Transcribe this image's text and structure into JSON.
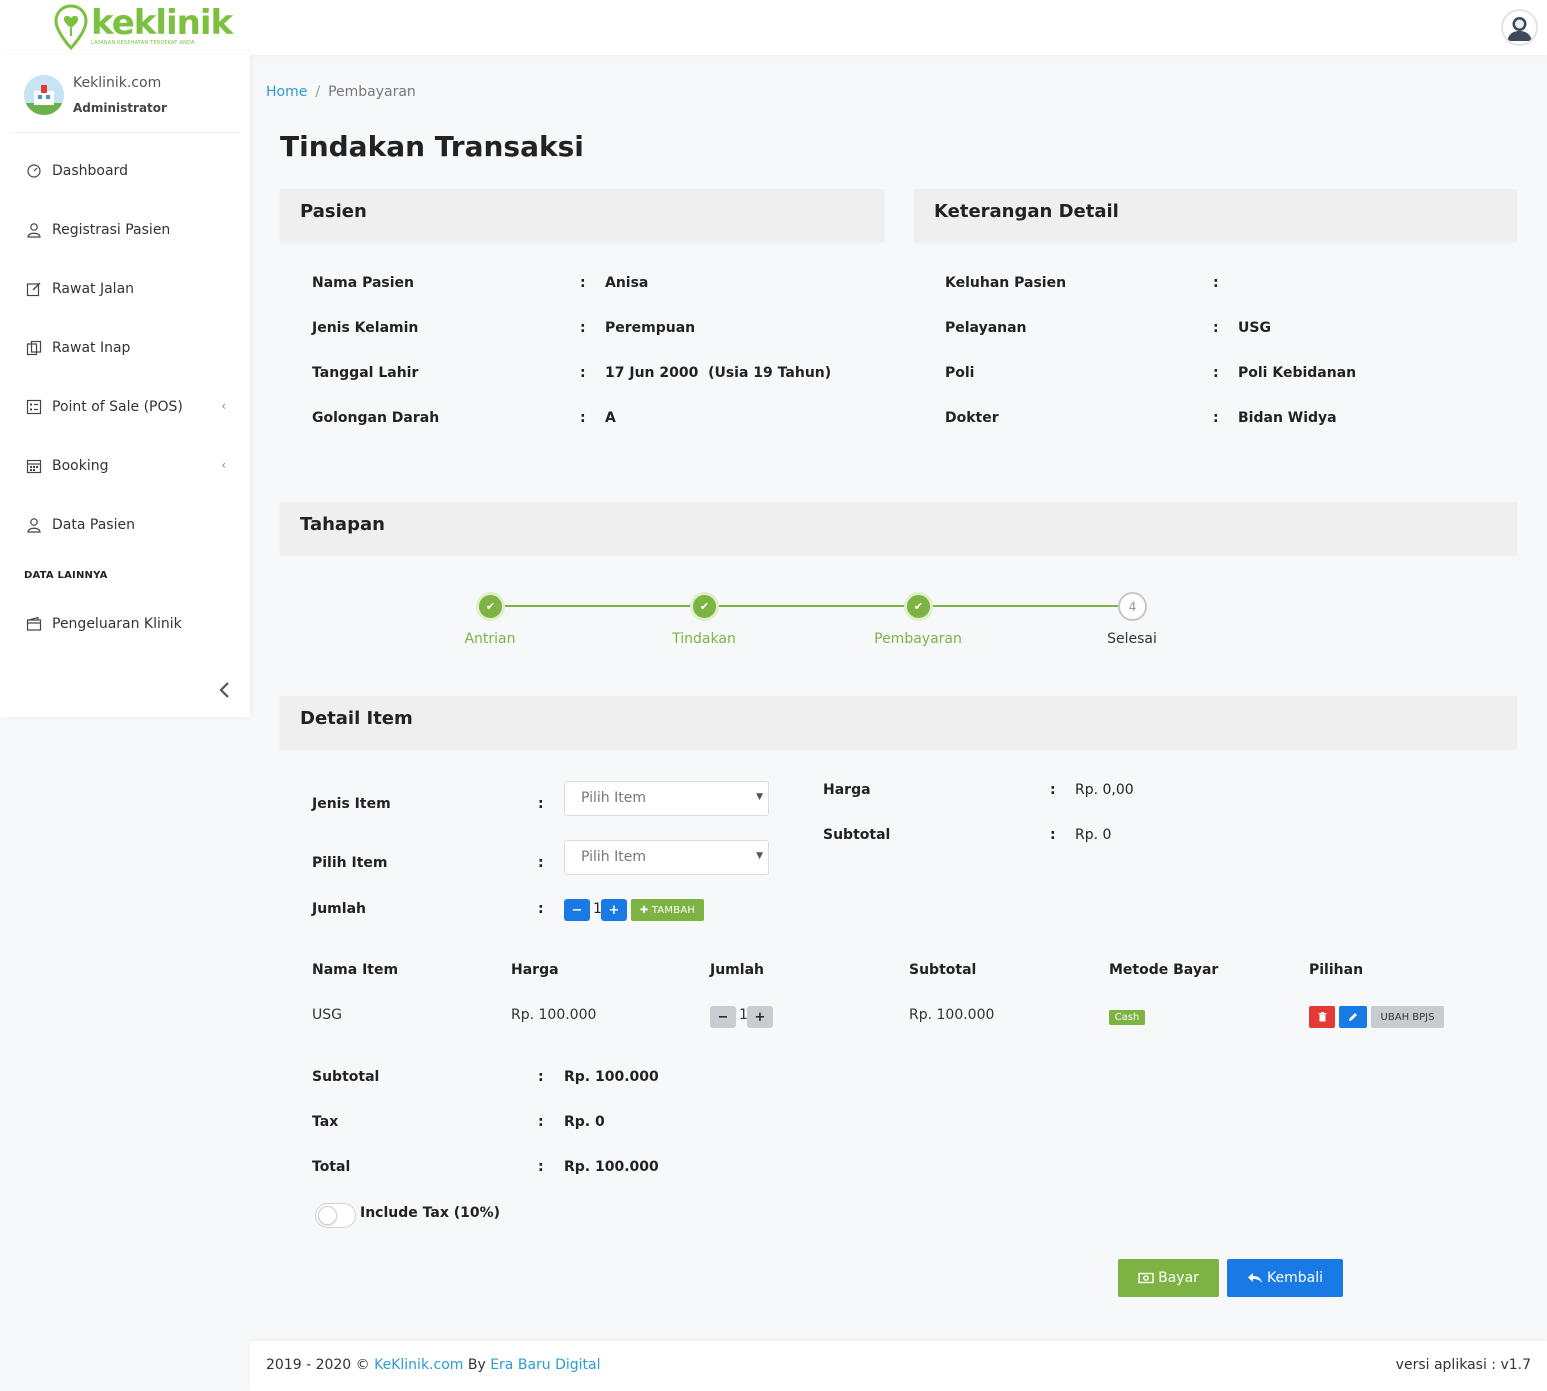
{
  "brand": {
    "name": "keklinik",
    "tagline": "LAYANAN KESEHATAN TERDEKAT ANDA"
  },
  "user": {
    "site": "Keklinik.com",
    "role": "Administrator"
  },
  "sidebar": {
    "items": [
      {
        "label": "Dashboard",
        "icon": "dashboard-icon"
      },
      {
        "label": "Registrasi Pasien",
        "icon": "user-icon"
      },
      {
        "label": "Rawat Jalan",
        "icon": "edit-icon"
      },
      {
        "label": "Rawat Inap",
        "icon": "copy-icon"
      },
      {
        "label": "Point of Sale (POS)",
        "icon": "list-icon",
        "chevron": "‹"
      },
      {
        "label": "Booking",
        "icon": "calendar-icon",
        "chevron": "‹"
      },
      {
        "label": "Data Pasien",
        "icon": "user-icon"
      }
    ],
    "section_label": "DATA LAINNYA",
    "extra_items": [
      {
        "label": "Pengeluaran Klinik",
        "icon": "wallet-icon"
      }
    ]
  },
  "breadcrumb": {
    "home": "Home",
    "separator": "/",
    "current": "Pembayaran"
  },
  "page_title": "Tindakan Transaksi",
  "pasien": {
    "title": "Pasien",
    "rows": [
      {
        "label": "Nama Pasien",
        "value": "Anisa"
      },
      {
        "label": "Jenis Kelamin",
        "value": "Perempuan"
      },
      {
        "label": "Tanggal Lahir",
        "value": "17 Jun 2000  (Usia 19 Tahun)"
      },
      {
        "label": "Golongan Darah",
        "value": "A"
      }
    ]
  },
  "keterangan": {
    "title": "Keterangan Detail",
    "rows": [
      {
        "label": "Keluhan Pasien",
        "value": ""
      },
      {
        "label": "Pelayanan",
        "value": "USG"
      },
      {
        "label": "Poli",
        "value": "Poli Kebidanan"
      },
      {
        "label": "Dokter",
        "value": "Bidan Widya"
      }
    ]
  },
  "tahapan": {
    "title": "Tahapan",
    "steps": [
      {
        "label": "Antrian",
        "done": true,
        "mark": "✔"
      },
      {
        "label": "Tindakan",
        "done": true,
        "mark": "✔"
      },
      {
        "label": "Pembayaran",
        "done": true,
        "mark": "✔"
      },
      {
        "label": "Selesai",
        "done": false,
        "mark": "4"
      }
    ]
  },
  "detail": {
    "title": "Detail Item",
    "colon": ":",
    "jenis_item": {
      "label": "Jenis Item",
      "placeholder": "Pilih Item"
    },
    "pilih_item": {
      "label": "Pilih Item",
      "placeholder": "Pilih Item"
    },
    "jumlah": {
      "label": "Jumlah",
      "value": "1",
      "minus": "−",
      "plus": "+",
      "add_label": "✚ TAMBAH"
    },
    "harga": {
      "label": "Harga",
      "value": "Rp. 0,00"
    },
    "subtotal": {
      "label": "Subtotal",
      "value": "Rp. 0"
    }
  },
  "table": {
    "headers": [
      "Nama Item",
      "Harga",
      "Jumlah",
      "Subtotal",
      "Metode Bayar",
      "Pilihan"
    ],
    "rows": [
      {
        "nama": "USG",
        "harga": "Rp. 100.000",
        "jumlah": "1",
        "subtotal": "Rp. 100.000",
        "metode": "Cash",
        "bpjs_label": "UBAH BPJS"
      }
    ]
  },
  "summary": {
    "rows": [
      {
        "label": "Subtotal",
        "value": "Rp. 100.000"
      },
      {
        "label": "Tax",
        "value": "Rp. 0"
      },
      {
        "label": "Total",
        "value": "Rp. 100.000"
      }
    ],
    "include_tax_label": "Include Tax (10%)",
    "include_tax": false
  },
  "actions": {
    "bayar": "Bayar",
    "kembali": "Kembali"
  },
  "footer": {
    "years": "2019 - 2020 ©",
    "site_link": "KeKlinik.com",
    "by": "By",
    "company_link": "Era Baru Digital",
    "version": "versi aplikasi : v1.7"
  },
  "colors": {
    "accent_green": "#7cb342",
    "primary_blue": "#1a7ae5",
    "danger_red": "#e53935",
    "link_blue": "#2d9bd6"
  }
}
